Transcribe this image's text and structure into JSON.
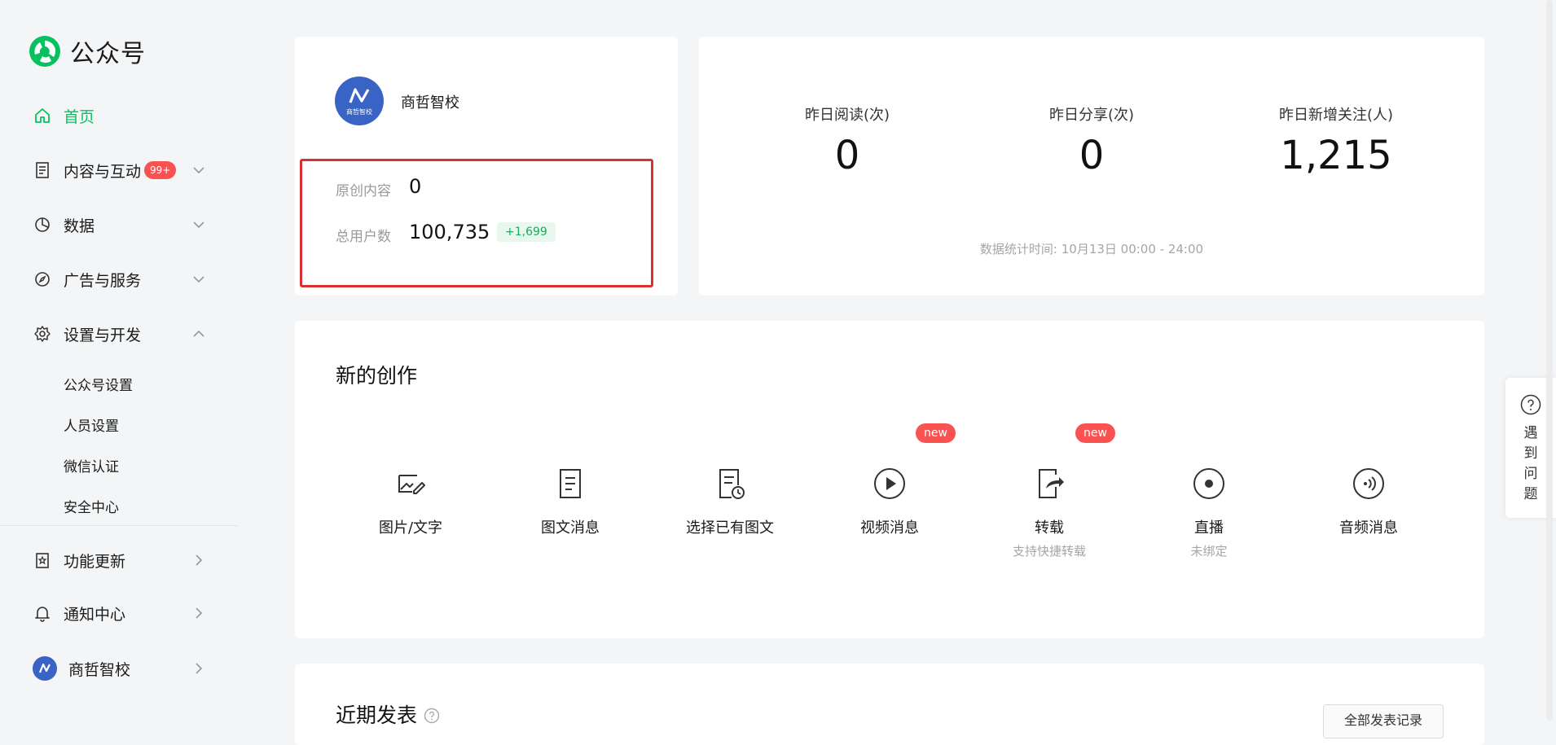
{
  "app": {
    "title": "公众号"
  },
  "sidebar": {
    "home": "首页",
    "content": {
      "label": "内容与互动",
      "badge": "99+"
    },
    "data": "数据",
    "ads": "广告与服务",
    "settings": "设置与开发",
    "sub_items": [
      "公众号设置",
      "人员设置",
      "微信认证",
      "安全中心"
    ],
    "updates": "功能更新",
    "notifications": "通知中心",
    "account": "商哲智校"
  },
  "account": {
    "name": "商哲智校",
    "avatar_text": "商哲智校",
    "original_label": "原创内容",
    "original_value": "0",
    "users_label": "总用户数",
    "users_value": "100,735",
    "users_delta": "+1,699"
  },
  "stats": {
    "items": [
      {
        "label": "昨日阅读(次)",
        "value": "0"
      },
      {
        "label": "昨日分享(次)",
        "value": "0"
      },
      {
        "label": "昨日新增关注(人)",
        "value": "1,215"
      }
    ],
    "note": "数据统计时间: 10月13日 00:00 - 24:00"
  },
  "create": {
    "title": "新的创作",
    "tools": [
      {
        "label": "图片/文字",
        "icon": "image-edit-icon"
      },
      {
        "label": "图文消息",
        "icon": "document-icon"
      },
      {
        "label": "选择已有图文",
        "icon": "document-clock-icon"
      },
      {
        "label": "视频消息",
        "icon": "play-icon",
        "badge": "new"
      },
      {
        "label": "转载",
        "icon": "share-icon",
        "badge": "new",
        "sub": "支持快捷转载"
      },
      {
        "label": "直播",
        "icon": "live-icon",
        "sub": "未绑定"
      },
      {
        "label": "音频消息",
        "icon": "audio-icon"
      }
    ]
  },
  "recent": {
    "title": "近期发表",
    "button": "全部发表记录"
  },
  "help": {
    "chars": [
      "遇",
      "到",
      "问",
      "题"
    ]
  },
  "colors": {
    "accent": "#07c160",
    "badge": "#fa5151",
    "highlight": "#d73131",
    "avatar": "#3a63c6"
  }
}
